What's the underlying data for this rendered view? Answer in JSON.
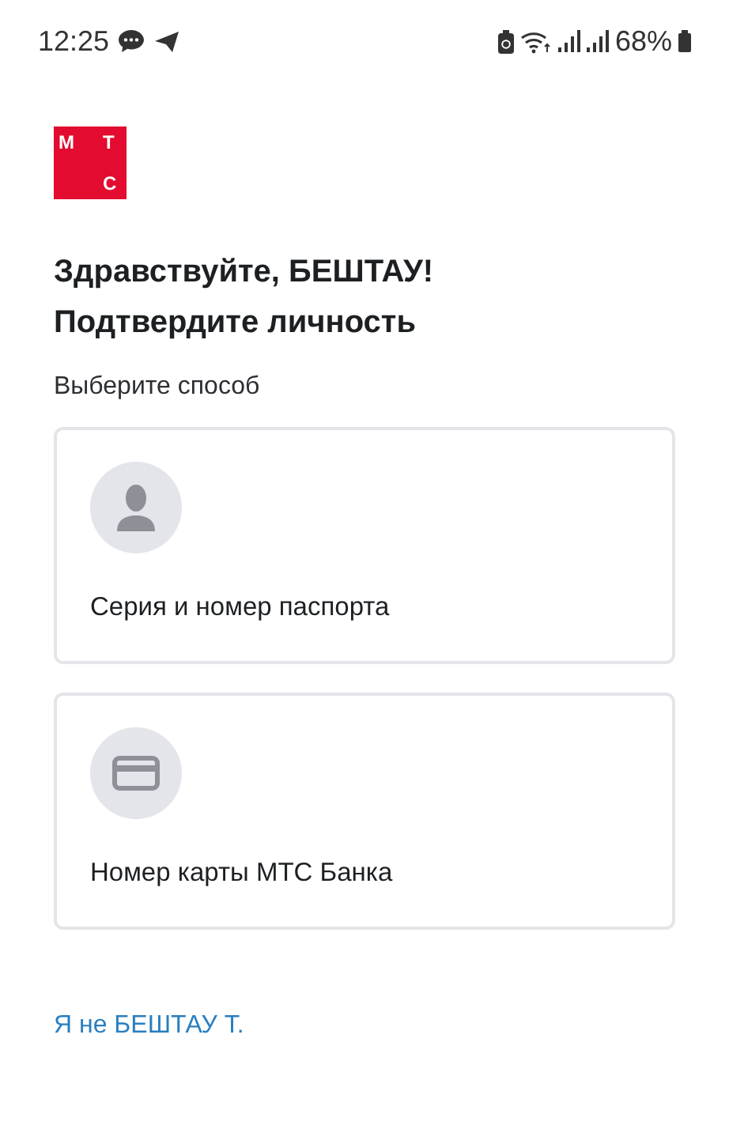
{
  "status_bar": {
    "time": "12:25",
    "battery": "68%"
  },
  "logo": {
    "letters": [
      "М",
      "Т",
      "С"
    ]
  },
  "heading": [
    "Здравствуйте, БЕШТАУ!",
    "Подтвердите личность"
  ],
  "subtitle": "Выберите способ",
  "options": [
    {
      "kind": "person",
      "label": "Серия и номер паспорта"
    },
    {
      "kind": "card",
      "label": "Номер карты МТС Банка"
    }
  ],
  "link": "Я не БЕШТАУ Т."
}
